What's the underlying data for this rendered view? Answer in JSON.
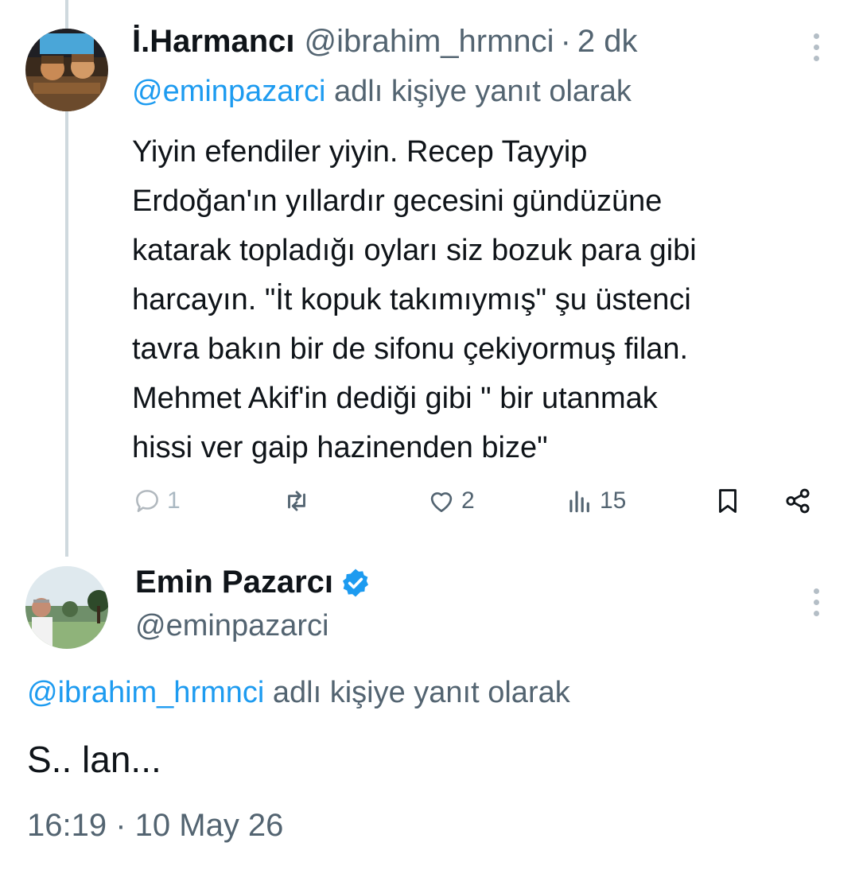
{
  "tweet1": {
    "name": "İ.Harmancı",
    "handle": "@ibrahim_hrmnci",
    "separator": "·",
    "time": "2 dk",
    "reply_mention": "@eminpazarci",
    "reply_suffix": " adlı kişiye yanıt olarak",
    "text_lines": [
      "Yiyin efendiler yiyin. Recep Tayyip",
      "Erdoğan'ın yıllardır gecesini gündüzüne",
      "katarak topladığı oyları siz bozuk para gibi",
      "harcayın. \"İt kopuk takımıymış\" şu üstenci",
      "tavra bakın bir de sifonu çekiyormuş filan.",
      "Mehmet Akif'in dediği gibi \" bir utanmak",
      "hissi ver gaip hazinenden bize\""
    ],
    "actions": {
      "replies": "1",
      "retweets": "",
      "likes": "2",
      "views": "15"
    },
    "icons": [
      "reply-icon",
      "retweet-icon",
      "like-icon",
      "views-icon",
      "bookmark-icon",
      "share-icon",
      "more-icon"
    ]
  },
  "tweet2": {
    "name": "Emin Pazarcı",
    "handle": "@eminpazarci",
    "reply_mention": "@ibrahim_hrmnci",
    "reply_suffix": " adlı kişiye yanıt olarak",
    "text": "S.. lan...",
    "timestamp": "16:19 · 10 May 26"
  },
  "colors": {
    "accent": "#1d9bf0",
    "secondary_text": "#536471",
    "primary_text": "#0f1419",
    "thread_line": "#cfd9de"
  }
}
